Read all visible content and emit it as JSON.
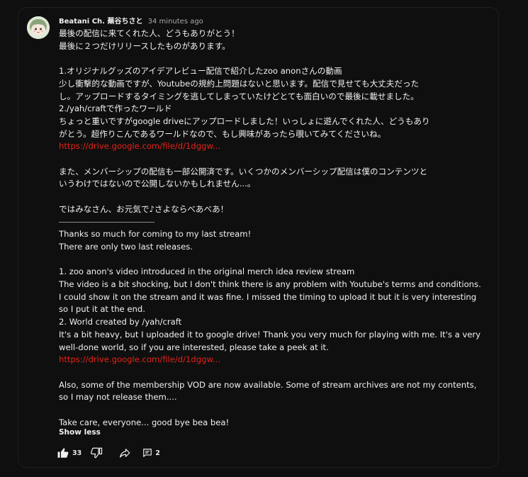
{
  "comment": {
    "author": "Beatani Ch. 蕪谷ちさと",
    "time": "34 minutes ago",
    "lines": [
      {
        "type": "text",
        "text": "最後の配信に来てくれた人、どうもありがとう！"
      },
      {
        "type": "text",
        "text": "最後に２つだけリリースしたものがあります。"
      },
      {
        "type": "blank",
        "text": ""
      },
      {
        "type": "text",
        "text": "1.オリジナルグッズのアイデアレビュー配信で紹介したzoo anonさんの動画"
      },
      {
        "type": "text",
        "text": "少し衝撃的な動画ですが、Youtubeの規約上問題はないと思います。配信で見せても大丈夫だった"
      },
      {
        "type": "text",
        "text": "し。アップロードするタイミングを逃してしまっていたけどとても面白いので最後に載せました。"
      },
      {
        "type": "text",
        "text": "2./yah/craftで作ったワールド"
      },
      {
        "type": "text",
        "text": "ちょっと重いですがgoogle driveにアップロードしました！いっしょに遊んでくれた人、どうもあり"
      },
      {
        "type": "text",
        "text": "がとう。超作りこんであるワールドなので、もし興味があったら覗いてみてくださいね。"
      },
      {
        "type": "link",
        "text": "https://drive.google.com/file/d/1dggw..."
      },
      {
        "type": "blank",
        "text": ""
      },
      {
        "type": "text",
        "text": "また、メンバーシップの配信も一部公開済です。いくつかのメンバーシップ配信は僕のコンテンツと"
      },
      {
        "type": "text",
        "text": "いうわけではないので公開しないかもしれません...。"
      },
      {
        "type": "blank",
        "text": ""
      },
      {
        "type": "text",
        "text": "ではみなさん、お元気で♪さよならべあべあ！"
      },
      {
        "type": "separator",
        "text": ""
      },
      {
        "type": "text",
        "text": "Thanks so much for coming to my last stream!"
      },
      {
        "type": "text",
        "text": "There are only two last releases."
      },
      {
        "type": "blank",
        "text": ""
      },
      {
        "type": "text",
        "text": "1. zoo anon's video introduced in the original merch idea review stream"
      },
      {
        "type": "text",
        "text": "The video is a bit shocking, but I don't think there is any problem with Youtube's terms and conditions."
      },
      {
        "type": "text",
        "text": "I could show it on the stream and it was fine. I missed the timing to upload it but it is very interesting"
      },
      {
        "type": "text",
        "text": "so I put it at the end."
      },
      {
        "type": "text",
        "text": "2. World created by /yah/craft"
      },
      {
        "type": "text",
        "text": "It's a bit heavy, but I uploaded it to google drive! Thank you very much for playing with me. It's a very"
      },
      {
        "type": "text",
        "text": "well-done world, so if you are interested, please take a peek at it."
      },
      {
        "type": "link",
        "text": "https://drive.google.com/file/d/1dggw..."
      },
      {
        "type": "blank",
        "text": ""
      },
      {
        "type": "text",
        "text": "Also, some of the membership VOD are now available. Some of stream archives are not my contents,"
      },
      {
        "type": "text",
        "text": "so I may not release them...."
      },
      {
        "type": "blank",
        "text": ""
      },
      {
        "type": "text",
        "text": "Take care, everyone... good bye bea bea!"
      }
    ],
    "show_less_label": "Show less",
    "like_count": "33",
    "reply_count": "2"
  },
  "icons": {
    "like": "thumb-up-icon",
    "dislike": "thumb-down-icon",
    "share": "share-icon",
    "replies": "comment-icon"
  },
  "colors": {
    "background": "#0f0f0f",
    "text": "#f1f1f1",
    "secondary_text": "#aaaaaa",
    "link": "#e62117"
  }
}
